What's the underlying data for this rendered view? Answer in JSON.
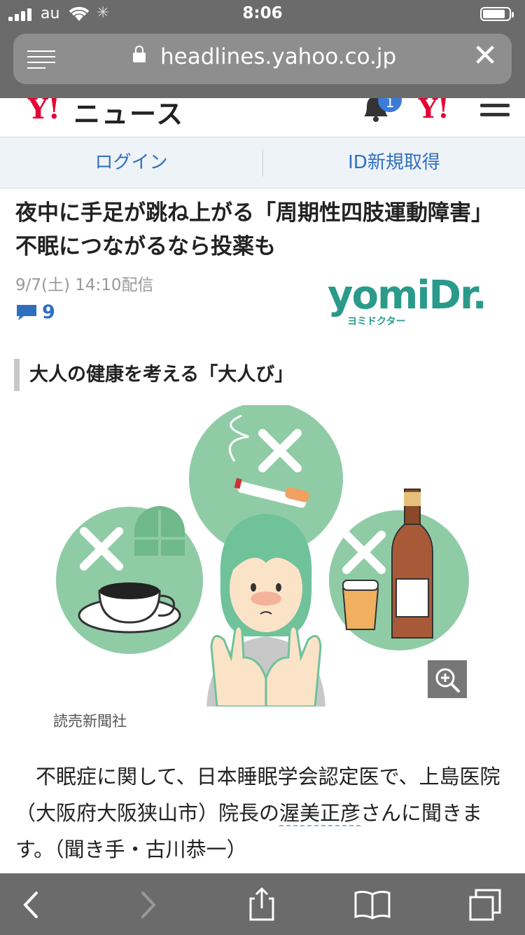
{
  "status_bar": {
    "carrier": "au",
    "time": "8:06",
    "battery_level": 0.85
  },
  "browser": {
    "url": "headlines.yahoo.co.jp",
    "reader_icon": "reader-view-icon",
    "close_icon": "close-icon"
  },
  "header": {
    "logo_y": "Y!",
    "logo_news": "ニュース",
    "notification_count": "1",
    "right_logo": "Y!"
  },
  "account": {
    "login_label": "ログイン",
    "register_label": "ID新規取得"
  },
  "article": {
    "title": "夜中に手足が跳ね上がる「周期性四肢運動障害」　不眠につながるなら投薬も",
    "date": "9/7(土) 14:10配信",
    "comment_count": "9",
    "source_logo": "yomiDr.",
    "source_logo_sub": "ヨミドクター",
    "series_label": "大人の健康を考える「大人び」",
    "image_caption": "読売新聞社",
    "body_before_link": "　不眠症に関して、日本睡眠学会認定医で、上島医院（大阪府大阪狭山市）院長の",
    "body_link": "渥美正彦",
    "body_after_link": "さんに聞きます。（聞き手・古川恭一）"
  },
  "toolbar": {
    "back": "back-icon",
    "forward": "forward-icon",
    "share": "share-icon",
    "bookmarks": "bookmarks-icon",
    "tabs": "tabs-icon"
  },
  "colors": {
    "yahoo_red": "#e60033",
    "link_blue": "#2f6fc0",
    "illustration_green": "#8fcca6",
    "browser_chrome": "#6b6b6b"
  }
}
